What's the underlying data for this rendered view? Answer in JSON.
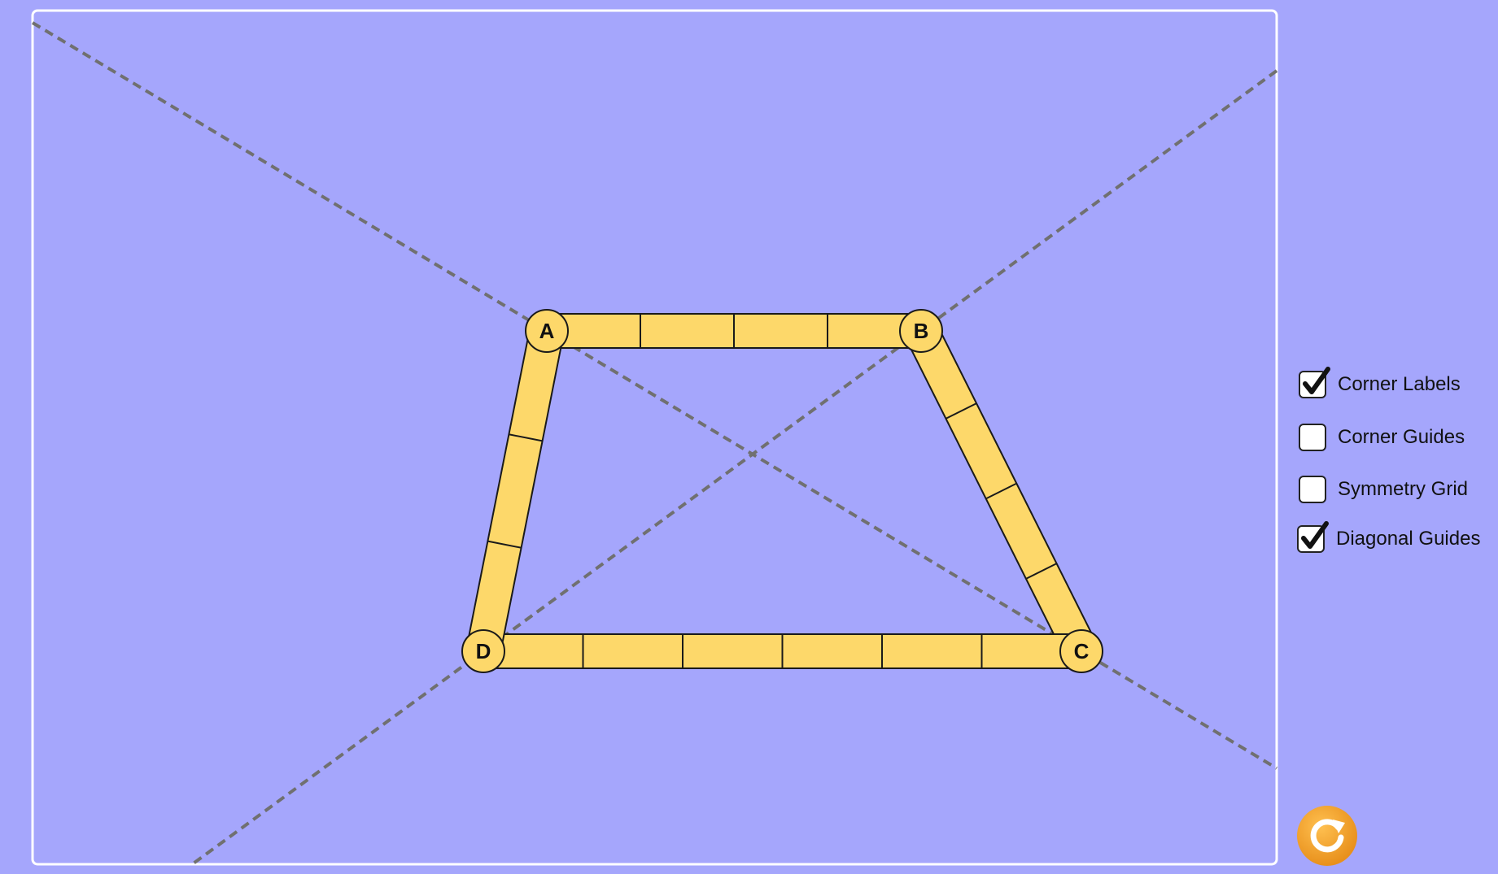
{
  "colors": {
    "background": "#a5a6fc",
    "frame": "#ffffff",
    "guide": "#707070",
    "bar_fill": "#fdd86a",
    "bar_stroke": "#1a1a1a",
    "reset_outer": "#f0a030",
    "reset_inner": "#ffffff"
  },
  "shape": {
    "type": "quadrilateral",
    "corners": [
      {
        "id": "A",
        "label": "A",
        "segments_to_next": 4
      },
      {
        "id": "B",
        "label": "B",
        "segments_to_next": 4
      },
      {
        "id": "C",
        "label": "C",
        "segments_to_next": 6
      },
      {
        "id": "D",
        "label": "D",
        "segments_to_next": 3
      }
    ]
  },
  "options": [
    {
      "key": "corner_labels",
      "label": "Corner Labels",
      "checked": true
    },
    {
      "key": "corner_guides",
      "label": "Corner Guides",
      "checked": false
    },
    {
      "key": "symmetry_grid",
      "label": "Symmetry Grid",
      "checked": false
    },
    {
      "key": "diagonal_guides",
      "label": "Diagonal Guides",
      "checked": true
    }
  ],
  "reset": {
    "icon": "reset-icon"
  }
}
